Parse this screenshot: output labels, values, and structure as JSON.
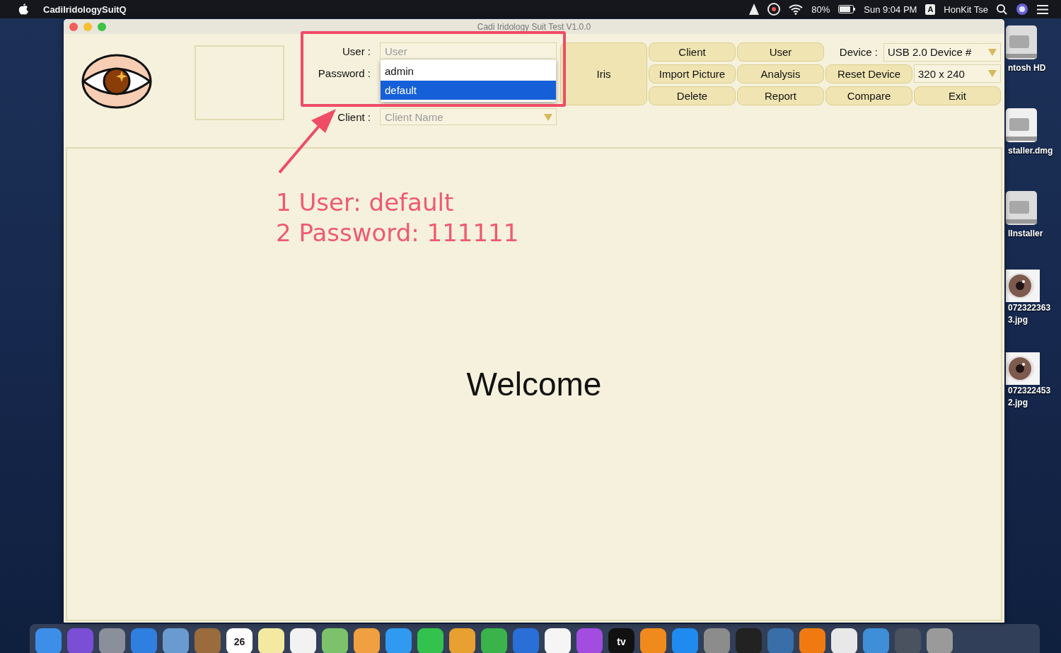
{
  "menubar": {
    "app_name": "CadiIridologySuitQ",
    "battery": "80%",
    "clock": "Sun 9:04 PM",
    "input_source": "A",
    "user": "HonKit Tse"
  },
  "window": {
    "title": "Cadi Iridology Suit Test V1.0.0"
  },
  "login": {
    "user_label": "User :",
    "user_placeholder": "User",
    "password_label": "Password :",
    "client_label": "Client :",
    "client_placeholder": "Client Name"
  },
  "user_dropdown": [
    {
      "label": "admin",
      "selected": false
    },
    {
      "label": "default",
      "selected": true
    }
  ],
  "toolbar": {
    "iris_button": "Iris",
    "columns": [
      [
        "Client",
        "Import Picture",
        "Delete"
      ],
      [
        "User",
        "Analysis",
        "Report"
      ]
    ],
    "device_label": "Device :",
    "device_value": "USB 2.0 Device #",
    "reset_button": "Reset Device",
    "resolution_value": "320 x 240",
    "compare_button": "Compare",
    "exit_button": "Exit"
  },
  "welcome": "Welcome",
  "annotation": [
    "1 User: default",
    "2 Password: 111111"
  ],
  "desktop_icons": [
    {
      "kind": "disk",
      "lines": [
        "ntosh HD"
      ]
    },
    {
      "kind": "dmg",
      "lines": [
        "staller.dmg"
      ]
    },
    {
      "kind": "installer",
      "lines": [
        "lInstaller"
      ]
    },
    {
      "lines": [
        "072322363",
        "3.jpg"
      ]
    },
    {
      "lines": [
        "072322453",
        "2.jpg"
      ]
    }
  ],
  "dock": [
    {
      "kind": "app",
      "color": "#3d8ee8"
    },
    {
      "kind": "app",
      "color": "#7a4fd6"
    },
    {
      "kind": "app",
      "color": "#8a8f99"
    },
    {
      "kind": "app",
      "color": "#2f7fe0"
    },
    {
      "kind": "app",
      "color": "#6a9bd0"
    },
    {
      "kind": "app",
      "color": "#9a6b3c"
    },
    {
      "kind": "calendar",
      "color": "#ffffff",
      "text": "26"
    },
    {
      "kind": "app",
      "color": "#f4e9a0"
    },
    {
      "kind": "app",
      "color": "#f2f2f2"
    },
    {
      "kind": "app",
      "color": "#7cc26b"
    },
    {
      "kind": "app",
      "color": "#f0a040"
    },
    {
      "kind": "app",
      "color": "#2f9af0"
    },
    {
      "kind": "app",
      "color": "#33c24d"
    },
    {
      "kind": "app",
      "color": "#e8a030"
    },
    {
      "kind": "app",
      "color": "#3ab34a"
    },
    {
      "kind": "app",
      "color": "#2a6fd8"
    },
    {
      "kind": "app",
      "color": "#f5f5f5"
    },
    {
      "kind": "app",
      "color": "#a24de0"
    },
    {
      "kind": "tv",
      "color": "#111111",
      "text": "tv"
    },
    {
      "kind": "app",
      "color": "#f08a1c"
    },
    {
      "kind": "app",
      "color": "#1f8bf0"
    },
    {
      "kind": "app",
      "color": "#8c8c8c"
    },
    {
      "kind": "app",
      "color": "#222222"
    },
    {
      "kind": "app",
      "color": "#3a6ea8"
    },
    {
      "kind": "app",
      "color": "#f07a10"
    },
    {
      "kind": "app",
      "color": "#e8e8e8"
    },
    {
      "kind": "app",
      "color": "#3f8fd8"
    },
    {
      "kind": "app",
      "color": "#4a5260"
    },
    {
      "kind": "app",
      "color": "#9a9a9a"
    }
  ]
}
